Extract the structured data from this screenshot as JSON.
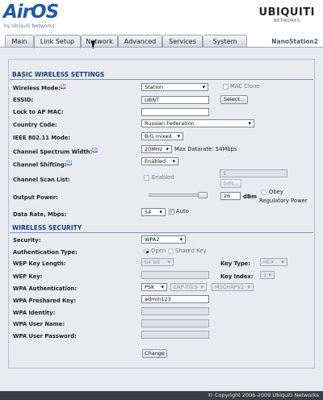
{
  "header": {
    "logo": "AirOS",
    "logo_sub": "by Ubiquiti Networks",
    "brand": "UBIQUITI",
    "brand_sub": "NETWORKS",
    "model": "NanoStation2"
  },
  "tabs": [
    {
      "label": "Main",
      "active": false
    },
    {
      "label": "Link Setup",
      "active": true
    },
    {
      "label": "Network",
      "active": false
    },
    {
      "label": "Advanced",
      "active": false
    },
    {
      "label": "Services",
      "active": false
    },
    {
      "label": "System",
      "active": false
    }
  ],
  "wireless": {
    "title": "BASIC WIRELESS SETTINGS",
    "help": "[?]",
    "mode": {
      "label": "Wireless Mode:",
      "value": "Station"
    },
    "mac_clone": {
      "label": "MAC Clone",
      "checked": false
    },
    "essid": {
      "label": "ESSID:",
      "value": "UBNT",
      "select_button": "Select..."
    },
    "lock_ap_mac": {
      "label": "Lock to AP MAC:",
      "value": ""
    },
    "country": {
      "label": "Country Code:",
      "value": "Russian Federation"
    },
    "ieee_mode": {
      "label": "IEEE 802.11 Mode:",
      "value": "B/G mixed"
    },
    "channel_width": {
      "label": "Channel Spectrum Width:",
      "value": "20MHz",
      "max_datarate": "Max Datarate: 54Mbps"
    },
    "channel_shifting": {
      "label": "Channel Shifting:",
      "value": "Enabled"
    },
    "scan_list": {
      "label": "Channel Scan List:",
      "enabled_label": "Enabled",
      "enabled": false,
      "value": "1",
      "edit_button": "Edit..."
    },
    "output_power": {
      "label": "Output Power:",
      "value": "26",
      "unit": "dBm",
      "obey_label": "Obey",
      "regulatory_label": "Regulatory Power",
      "level": 0.95
    },
    "data_rate": {
      "label": "Data Rate, Mbps:",
      "value": "54",
      "auto_label": "Auto",
      "auto": true
    }
  },
  "security": {
    "title": "WIRELESS SECURITY",
    "security": {
      "label": "Security:",
      "value": "WPA2"
    },
    "auth_type": {
      "label": "Authentication Type:",
      "open": "Open",
      "shared": "Shared Key"
    },
    "wep_len": {
      "label": "WEP Key Length:",
      "value": "64 bit"
    },
    "key_type": {
      "label": "Key Type:",
      "value": "HEX"
    },
    "wep_key": {
      "label": "WEP Key:",
      "value": ""
    },
    "key_index": {
      "label": "Key Index:",
      "value": "1"
    },
    "wpa_auth": {
      "label": "WPA Authentication:",
      "value": "PSK",
      "eap": "EAP-TTLS",
      "mschap": "MSCHAPV2"
    },
    "psk": {
      "label": "WPA Preshared Key:",
      "value": "admin123"
    },
    "identity": {
      "label": "WPA Identity:",
      "value": ""
    },
    "username": {
      "label": "WPA User Name:",
      "value": ""
    },
    "password": {
      "label": "WPA User Password:",
      "value": ""
    }
  },
  "change_button": "Change",
  "footer": "© Copyright 2006-2009 Ubiquiti Networks"
}
